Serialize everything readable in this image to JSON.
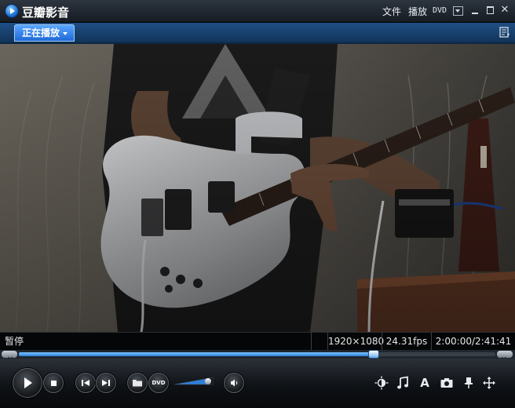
{
  "app": {
    "title": "豆瓣影音"
  },
  "menu": {
    "file": "文件",
    "play": "播放",
    "dvd": "DVD"
  },
  "tabs": {
    "now_playing": "正在播放"
  },
  "status": {
    "state": "暂停",
    "resolution": "1920×1080",
    "fps": "24.31fps",
    "time": "2:00:00/2:41:41"
  },
  "playback": {
    "progress": 0.743,
    "volume": 0.85
  },
  "colors": {
    "accent": "#2c7fd9",
    "tab": "#3b8cf0"
  },
  "icons": [
    "app-logo-icon",
    "dropdown-icon",
    "minimize-icon",
    "maximize-icon",
    "close-icon",
    "playlist-icon",
    "play-icon",
    "stop-icon",
    "prev-icon",
    "next-icon",
    "open-folder-icon",
    "dvd-icon",
    "volume-icon",
    "brightness-icon",
    "music-note-icon",
    "subtitle-icon",
    "camera-icon",
    "pin-icon",
    "move-icon"
  ]
}
